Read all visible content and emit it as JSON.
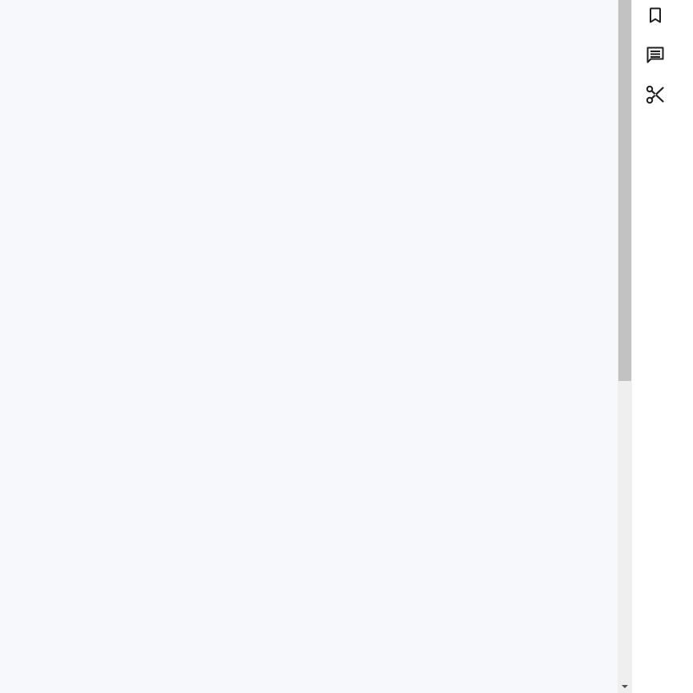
{
  "toolbar": {
    "items": [
      {
        "name": "bookmark",
        "icon": "bookmark-icon"
      },
      {
        "name": "comment",
        "icon": "comment-icon"
      },
      {
        "name": "cut",
        "icon": "scissors-icon"
      }
    ],
    "icon_color": "#1f1f1f"
  },
  "colors": {
    "content_background": "#f6f8fb",
    "scrollbar_track": "#efefef",
    "scrollbar_thumb": "#c2c2c2"
  },
  "scroll": {
    "thumb_fraction": 0.55
  }
}
